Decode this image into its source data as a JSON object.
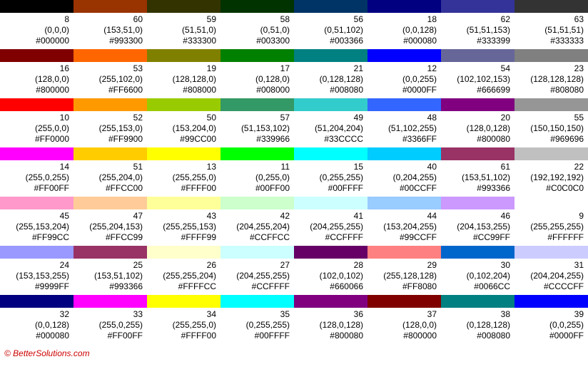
{
  "footer": "© BetterSolutions.com",
  "rows": [
    [
      {
        "id": "8",
        "rgb": "(0,0,0)",
        "hex": "#000000",
        "color": "#000000"
      },
      {
        "id": "60",
        "rgb": "(153,51,0)",
        "hex": "#993300",
        "color": "#993300"
      },
      {
        "id": "59",
        "rgb": "(51,51,0)",
        "hex": "#333300",
        "color": "#333300"
      },
      {
        "id": "58",
        "rgb": "(0,51,0)",
        "hex": "#003300",
        "color": "#003300"
      },
      {
        "id": "56",
        "rgb": "(0,51,102)",
        "hex": "#003366",
        "color": "#003366"
      },
      {
        "id": "18",
        "rgb": "(0,0,128)",
        "hex": "#000080",
        "color": "#000080"
      },
      {
        "id": "62",
        "rgb": "(51,51,153)",
        "hex": "#333399",
        "color": "#333399"
      },
      {
        "id": "63",
        "rgb": "(51,51,51)",
        "hex": "#333333",
        "color": "#333333"
      }
    ],
    [
      {
        "id": "16",
        "rgb": "(128,0,0)",
        "hex": "#800000",
        "color": "#800000"
      },
      {
        "id": "53",
        "rgb": "(255,102,0)",
        "hex": "#FF6600",
        "color": "#FF6600"
      },
      {
        "id": "19",
        "rgb": "(128,128,0)",
        "hex": "#808000",
        "color": "#808000"
      },
      {
        "id": "17",
        "rgb": "(0,128,0)",
        "hex": "#008000",
        "color": "#008000"
      },
      {
        "id": "21",
        "rgb": "(0,128,128)",
        "hex": "#008080",
        "color": "#008080"
      },
      {
        "id": "12",
        "rgb": "(0,0,255)",
        "hex": "#0000FF",
        "color": "#0000FF"
      },
      {
        "id": "54",
        "rgb": "(102,102,153)",
        "hex": "#666699",
        "color": "#666699"
      },
      {
        "id": "23",
        "rgb": "(128,128,128)",
        "hex": "#808080",
        "color": "#808080"
      }
    ],
    [
      {
        "id": "10",
        "rgb": "(255,0,0)",
        "hex": "#FF0000",
        "color": "#FF0000"
      },
      {
        "id": "52",
        "rgb": "(255,153,0)",
        "hex": "#FF9900",
        "color": "#FF9900"
      },
      {
        "id": "50",
        "rgb": "(153,204,0)",
        "hex": "#99CC00",
        "color": "#99CC00"
      },
      {
        "id": "57",
        "rgb": "(51,153,102)",
        "hex": "#339966",
        "color": "#339966"
      },
      {
        "id": "49",
        "rgb": "(51,204,204)",
        "hex": "#33CCCC",
        "color": "#33CCCC"
      },
      {
        "id": "48",
        "rgb": "(51,102,255)",
        "hex": "#3366FF",
        "color": "#3366FF"
      },
      {
        "id": "20",
        "rgb": "(128,0,128)",
        "hex": "#800080",
        "color": "#800080"
      },
      {
        "id": "55",
        "rgb": "(150,150,150)",
        "hex": "#969696",
        "color": "#969696"
      }
    ],
    [
      {
        "id": "14",
        "rgb": "(255,0,255)",
        "hex": "#FF00FF",
        "color": "#FF00FF"
      },
      {
        "id": "51",
        "rgb": "(255,204,0)",
        "hex": "#FFCC00",
        "color": "#FFCC00"
      },
      {
        "id": "13",
        "rgb": "(255,255,0)",
        "hex": "#FFFF00",
        "color": "#FFFF00"
      },
      {
        "id": "11",
        "rgb": "(0,255,0)",
        "hex": "#00FF00",
        "color": "#00FF00"
      },
      {
        "id": "15",
        "rgb": "(0,255,255)",
        "hex": "#00FFFF",
        "color": "#00FFFF"
      },
      {
        "id": "40",
        "rgb": "(0,204,255)",
        "hex": "#00CCFF",
        "color": "#00CCFF"
      },
      {
        "id": "61",
        "rgb": "(153,51,102)",
        "hex": "#993366",
        "color": "#993366"
      },
      {
        "id": "22",
        "rgb": "(192,192,192)",
        "hex": "#C0C0C0",
        "color": "#C0C0C0"
      }
    ],
    [
      {
        "id": "45",
        "rgb": "(255,153,204)",
        "hex": "#FF99CC",
        "color": "#FF99CC"
      },
      {
        "id": "47",
        "rgb": "(255,204,153)",
        "hex": "#FFCC99",
        "color": "#FFCC99"
      },
      {
        "id": "43",
        "rgb": "(255,255,153)",
        "hex": "#FFFF99",
        "color": "#FFFF99"
      },
      {
        "id": "42",
        "rgb": "(204,255,204)",
        "hex": "#CCFFCC",
        "color": "#CCFFCC"
      },
      {
        "id": "41",
        "rgb": "(204,255,255)",
        "hex": "#CCFFFF",
        "color": "#CCFFFF"
      },
      {
        "id": "44",
        "rgb": "(153,204,255)",
        "hex": "#99CCFF",
        "color": "#99CCFF"
      },
      {
        "id": "46",
        "rgb": "(204,153,255)",
        "hex": "#CC99FF",
        "color": "#CC99FF"
      },
      {
        "id": "9",
        "rgb": "(255,255,255)",
        "hex": "#FFFFFF",
        "color": "#FFFFFF"
      }
    ],
    [
      {
        "id": "24",
        "rgb": "(153,153,255)",
        "hex": "#9999FF",
        "color": "#9999FF"
      },
      {
        "id": "25",
        "rgb": "(153,51,102)",
        "hex": "#993366",
        "color": "#993366"
      },
      {
        "id": "26",
        "rgb": "(255,255,204)",
        "hex": "#FFFFCC",
        "color": "#FFFFCC"
      },
      {
        "id": "27",
        "rgb": "(204,255,255)",
        "hex": "#CCFFFF",
        "color": "#CCFFFF"
      },
      {
        "id": "28",
        "rgb": "(102,0,102)",
        "hex": "#660066",
        "color": "#660066"
      },
      {
        "id": "29",
        "rgb": "(255,128,128)",
        "hex": "#FF8080",
        "color": "#FF8080"
      },
      {
        "id": "30",
        "rgb": "(0,102,204)",
        "hex": "#0066CC",
        "color": "#0066CC"
      },
      {
        "id": "31",
        "rgb": "(204,204,255)",
        "hex": "#CCCCFF",
        "color": "#CCCCFF"
      }
    ],
    [
      {
        "id": "32",
        "rgb": "(0,0,128)",
        "hex": "#000080",
        "color": "#000080"
      },
      {
        "id": "33",
        "rgb": "(255,0,255)",
        "hex": "#FF00FF",
        "color": "#FF00FF"
      },
      {
        "id": "34",
        "rgb": "(255,255,0)",
        "hex": "#FFFF00",
        "color": "#FFFF00"
      },
      {
        "id": "35",
        "rgb": "(0,255,255)",
        "hex": "#00FFFF",
        "color": "#00FFFF"
      },
      {
        "id": "36",
        "rgb": "(128,0,128)",
        "hex": "#800080",
        "color": "#800080"
      },
      {
        "id": "37",
        "rgb": "(128,0,0)",
        "hex": "#800000",
        "color": "#800000"
      },
      {
        "id": "38",
        "rgb": "(0,128,128)",
        "hex": "#008080",
        "color": "#008080"
      },
      {
        "id": "39",
        "rgb": "(0,0,255)",
        "hex": "#0000FF",
        "color": "#0000FF"
      }
    ]
  ]
}
